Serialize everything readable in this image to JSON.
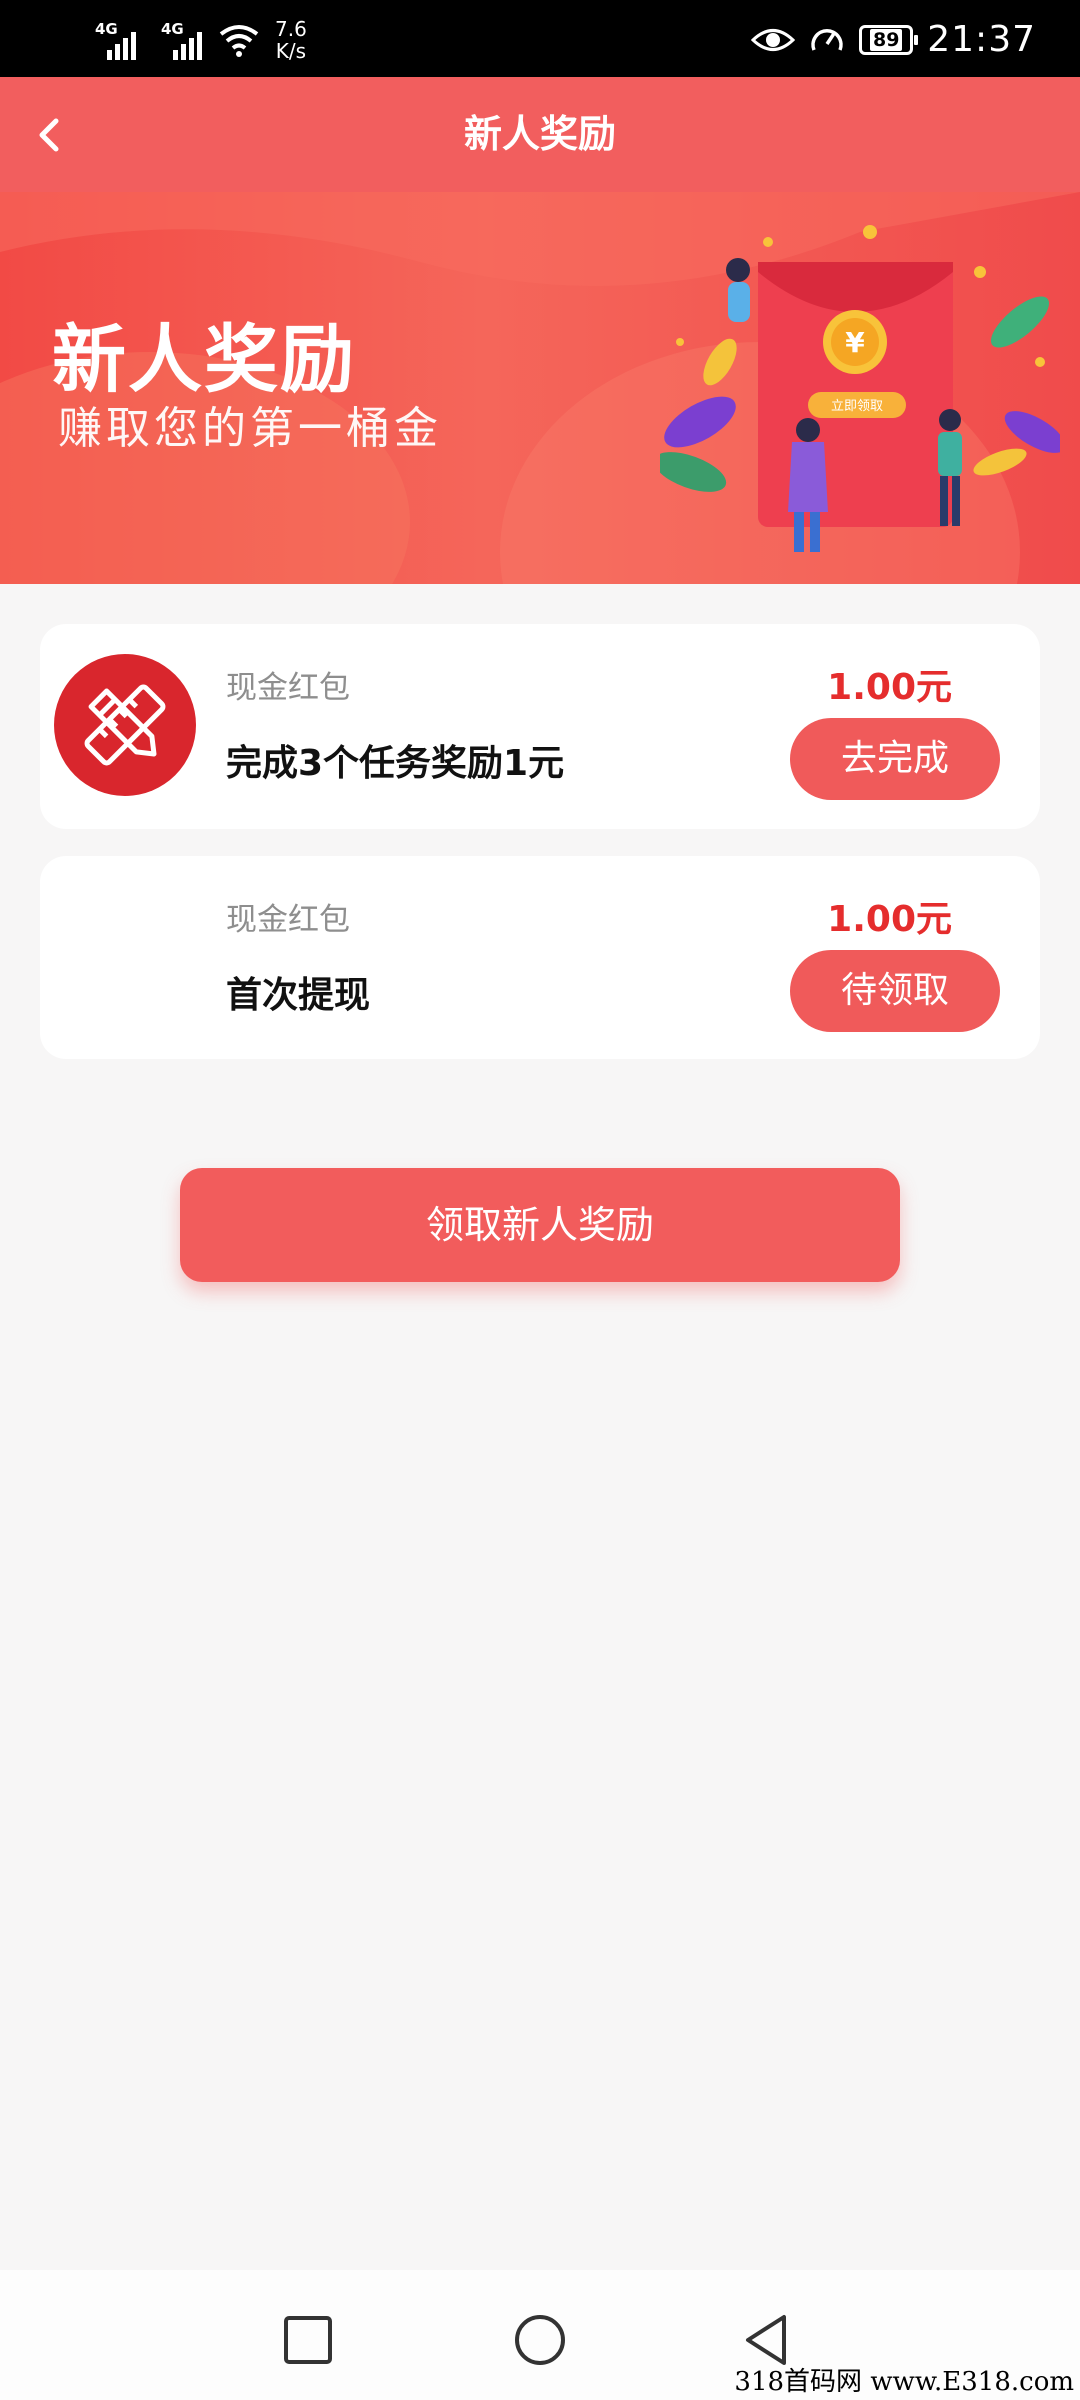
{
  "status_bar": {
    "network1": "4G",
    "network2": "4G",
    "speed_value": "7.6",
    "speed_unit": "K/s",
    "battery": "89",
    "time": "21:37",
    "icons": [
      "signal-icon",
      "wifi-icon",
      "eye-icon",
      "speedometer-icon",
      "battery-icon"
    ]
  },
  "header": {
    "title": "新人奖励",
    "back_icon": "chevron-left-icon"
  },
  "banner": {
    "title": "新人奖励",
    "subtitle": "赚取您的第一桶金",
    "illustration_button": "立即领取",
    "coin_symbol": "¥"
  },
  "rewards": [
    {
      "label": "现金红包",
      "task": "完成3个任务奖励1元",
      "amount": "1.00元",
      "button": "去完成",
      "icon": "tools-icon"
    },
    {
      "label": "现金红包",
      "task": "首次提现",
      "amount": "1.00元",
      "button": "待领取"
    }
  ],
  "claim_button": "领取新人奖励",
  "nav_bar": {
    "icons": [
      "recent-apps-icon",
      "home-icon",
      "back-icon"
    ]
  },
  "watermark": "318首码网 www.E318.com",
  "colors": {
    "accent": "#f25e5e",
    "amount": "#e52d2d",
    "background": "#f7f6f6"
  }
}
